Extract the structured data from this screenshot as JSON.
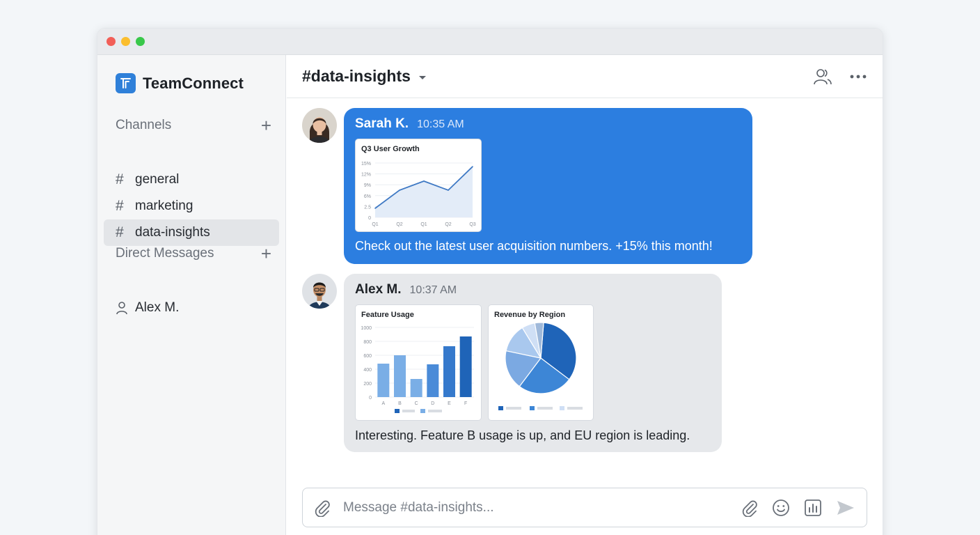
{
  "app": {
    "name": "TeamConnect"
  },
  "sidebar": {
    "channels_label": "Channels",
    "add_label": "+",
    "channels": [
      {
        "hash": "#",
        "name": "general"
      },
      {
        "hash": "#",
        "name": "marketing"
      },
      {
        "hash": "#",
        "name": "data-insights",
        "active": true
      }
    ],
    "dm_label": "Direct Messages",
    "dms": [
      {
        "name": "Alex M.",
        "icon": "user-icon"
      }
    ]
  },
  "header": {
    "channel": "#data-insights",
    "icons": [
      "members-icon",
      "more-icon"
    ]
  },
  "messages": [
    {
      "author": "Sarah K.",
      "time": "10:35 AM",
      "text": "Check out the latest user acquisition numbers. +15% this month!",
      "bubble_color": "#2c7ee0"
    },
    {
      "author": "Alex M.",
      "time": "10:37 AM",
      "text": "Interesting. Feature B usage is up, and EU region is leading.",
      "bubble_color": "#e6e8eb"
    }
  ],
  "chart_data": [
    {
      "type": "area",
      "title": "Q3 User Growth",
      "x": [
        "Q1",
        "Q2",
        "Q1",
        "Q2",
        "Q3"
      ],
      "values": [
        2.5,
        7.5,
        10,
        7.5,
        14
      ],
      "yticks": [
        "0",
        "2.5",
        "6%",
        "9%",
        "12%",
        "15%"
      ],
      "ylim": [
        0,
        15
      ],
      "color": "#3f79c4"
    },
    {
      "type": "bar",
      "title": "Feature Usage",
      "categories": [
        "A",
        "B",
        "C",
        "D",
        "E",
        "F"
      ],
      "values": [
        480,
        600,
        260,
        470,
        730,
        870
      ],
      "yticks": [
        "0",
        "200",
        "400",
        "600",
        "800",
        "1000"
      ],
      "ylim": [
        0,
        1000
      ],
      "colors": [
        "#7aaee6",
        "#7aaee6",
        "#7aaee6",
        "#4a8bd8",
        "#3579cc",
        "#1f64b8"
      ]
    },
    {
      "type": "pie",
      "title": "Revenue by Region",
      "values": [
        34,
        25,
        18,
        13,
        6,
        4
      ],
      "colors": [
        "#1f64b8",
        "#3d86d6",
        "#7ba9e2",
        "#a9c8ee",
        "#cfdff5",
        "#9fb9da"
      ]
    }
  ],
  "composer": {
    "placeholder": "Message #data-insights..."
  }
}
